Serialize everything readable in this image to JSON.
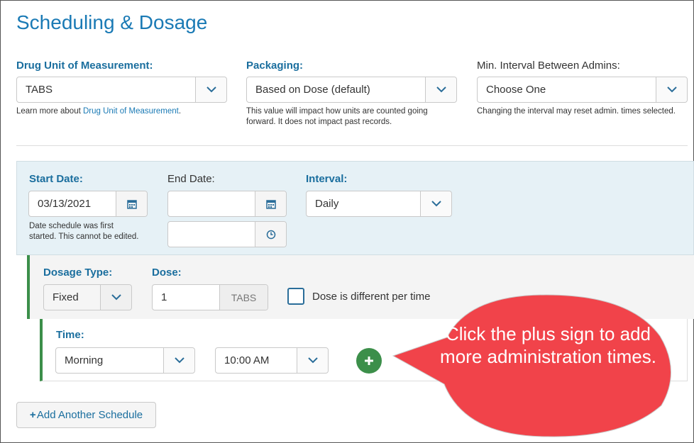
{
  "section_title": "Scheduling & Dosage",
  "unit_of_measure": {
    "label": "Drug Unit of Measurement:",
    "value": "TABS",
    "help_prefix": "Learn more about ",
    "help_link": "Drug Unit of Measurement",
    "help_suffix": "."
  },
  "packaging": {
    "label": "Packaging:",
    "value": "Based on Dose (default)",
    "help_line1": "This value will impact how units are counted going",
    "help_line2": "forward. It does not impact past records."
  },
  "min_interval": {
    "label": "Min. Interval Between Admins:",
    "value": "Choose One",
    "help": "Changing the interval may reset admin. times selected."
  },
  "schedule": {
    "start_date_label": "Start Date:",
    "start_date_value": "03/13/2021",
    "start_help_line1": "Date schedule was first",
    "start_help_line2": "started. This cannot be edited.",
    "end_date_label": "End Date:",
    "end_date_value": "",
    "end_time_value": "",
    "interval_label": "Interval:",
    "interval_value": "Daily"
  },
  "dosage": {
    "type_label": "Dosage Type:",
    "type_value": "Fixed",
    "dose_label": "Dose:",
    "dose_value": "1",
    "dose_unit": "TABS",
    "different_label": "Dose is different per time"
  },
  "time": {
    "label": "Time:",
    "period_value": "Morning",
    "clock_value": "10:00 AM"
  },
  "add_schedule_label": "Add Another Schedule",
  "callout_text": "Click the plus sign to add more administration times.",
  "colors": {
    "accent": "#1a7ab5",
    "green": "#3c8f4a",
    "callout": "#f1434a"
  }
}
